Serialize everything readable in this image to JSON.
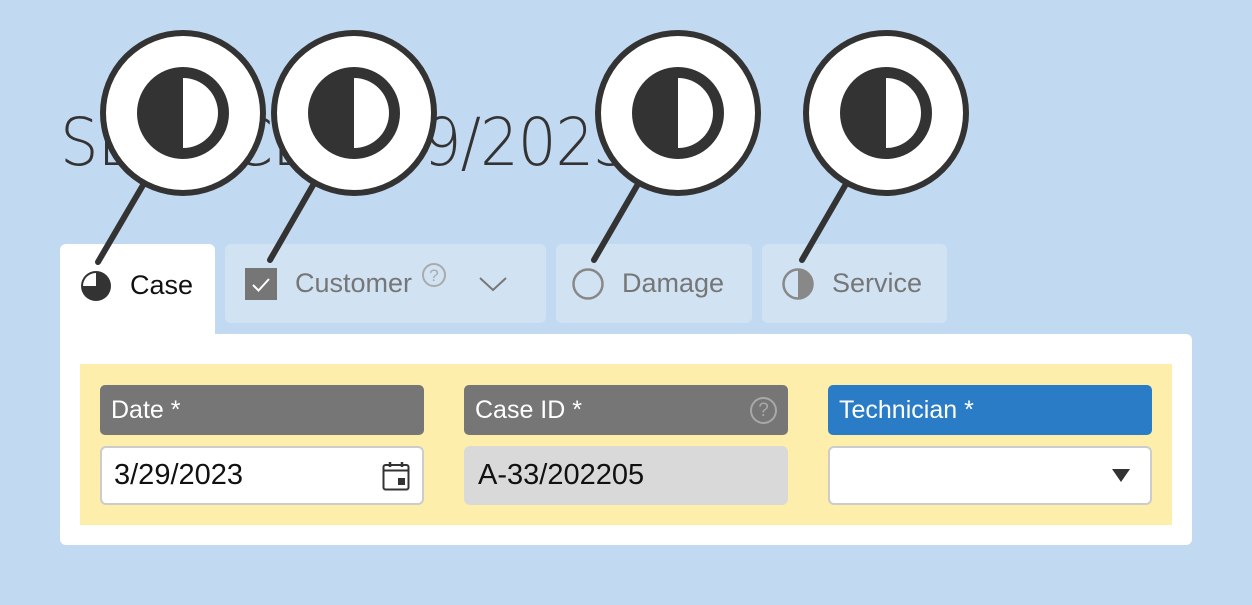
{
  "page": {
    "title": "SERVICE 3/29/2023"
  },
  "tabs": [
    {
      "id": "case",
      "label": "Case",
      "icon": "progress-three-quarter-icon",
      "state": "active"
    },
    {
      "id": "customer",
      "label": "Customer",
      "icon": "checkbox-checked-icon",
      "help_icon": "help-circle-icon",
      "help_glyph": "?",
      "expand_icon": "chevron-down-icon",
      "state": "inactive"
    },
    {
      "id": "damage",
      "label": "Damage",
      "icon": "circle-empty-icon",
      "state": "inactive"
    },
    {
      "id": "service",
      "label": "Service",
      "icon": "circle-half-icon",
      "state": "inactive"
    }
  ],
  "form": {
    "fields": [
      {
        "id": "date",
        "label": "Date *",
        "value": "3/29/2023",
        "icon": "calendar-icon",
        "type": "date"
      },
      {
        "id": "case_id",
        "label": "Case ID *",
        "value": "A-33/202205",
        "help_glyph": "?",
        "readonly": true
      },
      {
        "id": "technician",
        "label": "Technician *",
        "value": "",
        "type": "select",
        "icon": "dropdown-triangle-icon"
      }
    ]
  },
  "colors": {
    "background": "#c2d9f2",
    "tab_inactive": "#d1e2f3",
    "field_group": "#fdeeac",
    "label_gray": "#767676",
    "label_blue": "#2a7cc7",
    "readonly_input": "#d9d9d9"
  },
  "callouts": [
    {
      "target": "case-tab-icon",
      "icon": "circle-half-icon"
    },
    {
      "target": "customer-tab-icon",
      "icon": "circle-half-icon"
    },
    {
      "target": "damage-tab-icon",
      "icon": "circle-half-icon"
    },
    {
      "target": "service-tab-icon",
      "icon": "circle-half-icon"
    }
  ]
}
